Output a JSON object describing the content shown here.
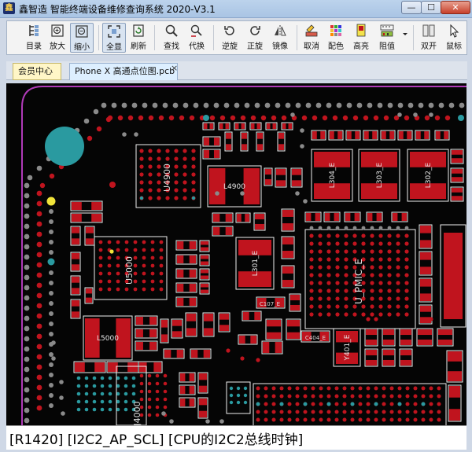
{
  "window": {
    "title": "鑫智造 智能终端设备维修查询系统 2020-V3.1",
    "app_icon_glyph": "鑫"
  },
  "window_controls": {
    "minimize": "—",
    "maximize": "☐",
    "close": "✕"
  },
  "toolbar": [
    {
      "key": "catalog",
      "label": "目录",
      "icon": "catalog-icon"
    },
    {
      "key": "zoom_in",
      "label": "放大",
      "icon": "zoom-in-icon"
    },
    {
      "key": "zoom_out",
      "label": "缩小",
      "icon": "zoom-out-icon",
      "pressed": true
    },
    {
      "key": "fit_all",
      "label": "全显",
      "icon": "fit-all-icon",
      "pressed": true
    },
    {
      "key": "refresh",
      "label": "刷新",
      "icon": "refresh-icon"
    },
    {
      "key": "find",
      "label": "查找",
      "icon": "search-icon"
    },
    {
      "key": "replace",
      "label": "代换",
      "icon": "replace-icon"
    },
    {
      "key": "rotate_ccw",
      "label": "逆旋",
      "icon": "rotate-ccw-icon"
    },
    {
      "key": "rotate_cw",
      "label": "正旋",
      "icon": "rotate-cw-icon"
    },
    {
      "key": "mirror",
      "label": "镜像",
      "icon": "mirror-icon"
    },
    {
      "key": "cancel",
      "label": "取消",
      "icon": "eraser-icon"
    },
    {
      "key": "color",
      "label": "配色",
      "icon": "palette-icon"
    },
    {
      "key": "highlight",
      "label": "高亮",
      "icon": "highlight-icon"
    },
    {
      "key": "resistance",
      "label": "阻值",
      "icon": "resistance-icon"
    },
    {
      "key": "dual_open",
      "label": "双开",
      "icon": "dual-window-icon"
    },
    {
      "key": "mouse",
      "label": "鼠标",
      "icon": "cursor-icon"
    }
  ],
  "tabs": [
    {
      "label": "会员中心"
    },
    {
      "label": "Phone X 高通点位图.pcb",
      "close": "×"
    }
  ],
  "pcb": {
    "colors": {
      "board": "#050505",
      "pad": "#c0141e",
      "via": "#8a8a8a",
      "teal": "#2a9aa0",
      "outline": "#f0f0f0",
      "yellow": "#f1e43a",
      "purple": "#b03ab8"
    },
    "labels": [
      "L4900",
      "L304_E",
      "L303_E",
      "L302_E",
      "U4900",
      "L301_E",
      "U_PMIC_E",
      "U5000",
      "L5000",
      "Y401_E",
      "C107_E",
      "C404_E",
      "J4000"
    ]
  },
  "status": {
    "text": "[R1420] [I2C2_AP_SCL] [CPU的I2C2总线时钟]"
  }
}
